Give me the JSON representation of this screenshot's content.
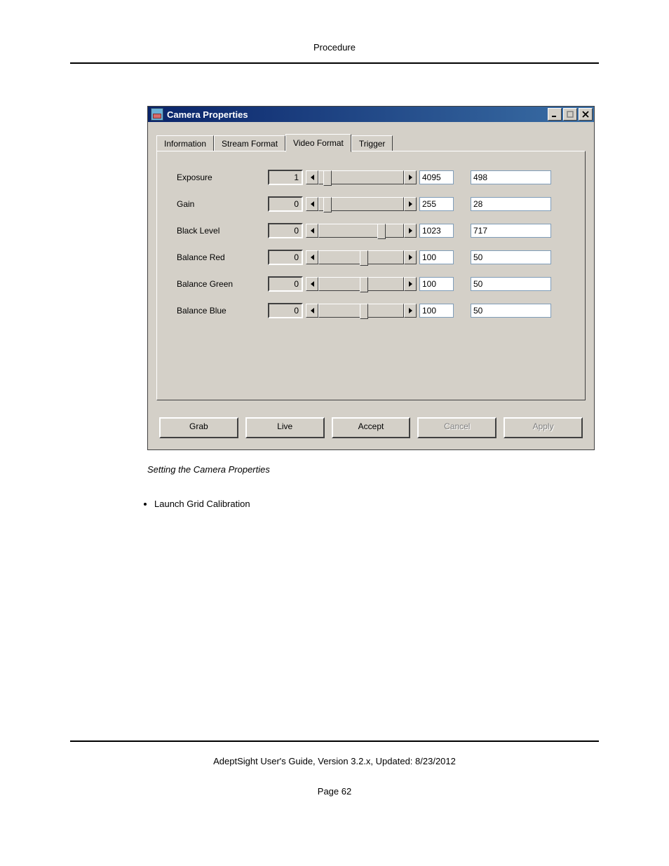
{
  "header": {
    "title": "Procedure"
  },
  "dialog": {
    "title": "Camera Properties",
    "tabs": {
      "t0": "Information",
      "t1": "Stream Format",
      "t2": "Video Format",
      "t3": "Trigger"
    },
    "params": {
      "exposure": {
        "label": "Exposure",
        "min": "1",
        "max": "4095",
        "value": "498",
        "thumb_pct": 5
      },
      "gain": {
        "label": "Gain",
        "min": "0",
        "max": "255",
        "value": "28",
        "thumb_pct": 5
      },
      "black_level": {
        "label": "Black Level",
        "min": "0",
        "max": "1023",
        "value": "717",
        "thumb_pct": 69
      },
      "balance_red": {
        "label": "Balance Red",
        "min": "0",
        "max": "100",
        "value": "50",
        "thumb_pct": 48
      },
      "balance_green": {
        "label": "Balance Green",
        "min": "0",
        "max": "100",
        "value": "50",
        "thumb_pct": 48
      },
      "balance_blue": {
        "label": "Balance Blue",
        "min": "0",
        "max": "100",
        "value": "50",
        "thumb_pct": 48
      }
    },
    "buttons": {
      "grab": "Grab",
      "live": "Live",
      "accept": "Accept",
      "cancel": "Cancel",
      "apply": "Apply"
    }
  },
  "caption": "Setting the Camera Properties",
  "bullets": {
    "b0": "Launch Grid Calibration"
  },
  "footer": {
    "line": "AdeptSight User's Guide,  Version 3.2.x, Updated: 8/23/2012",
    "page": "Page 62"
  }
}
